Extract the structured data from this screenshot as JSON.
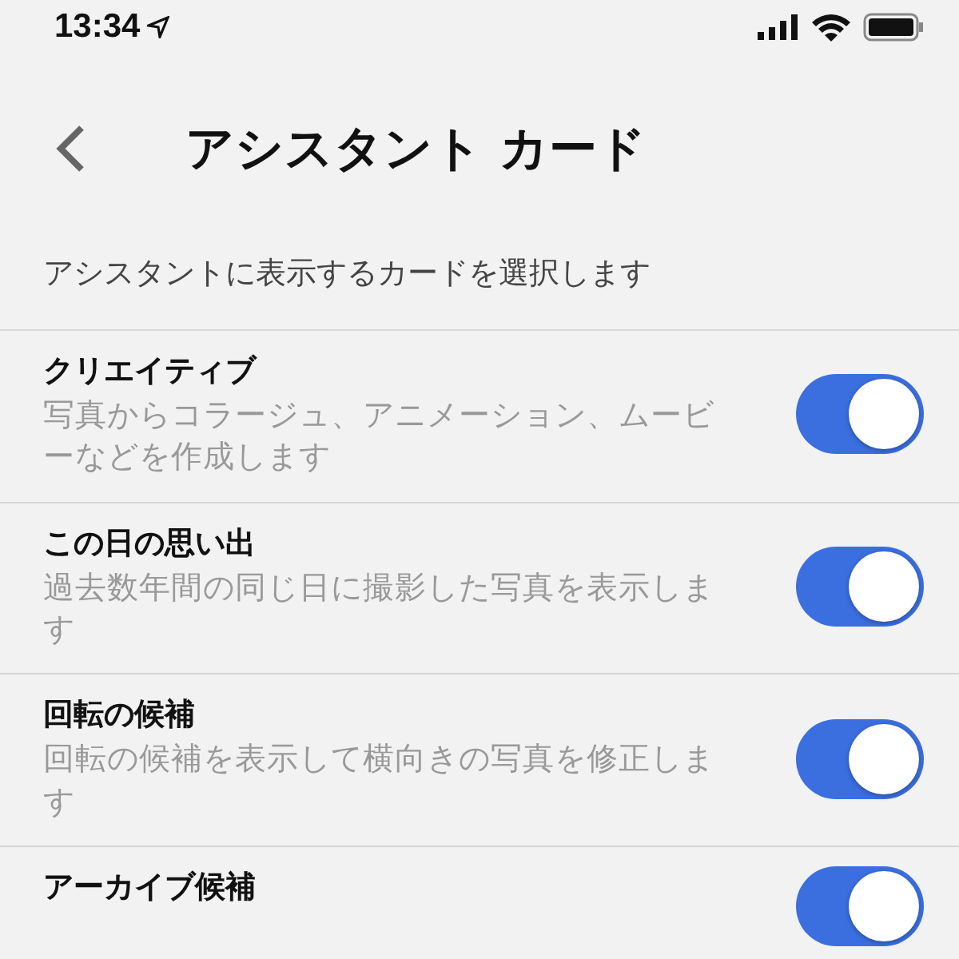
{
  "status_bar": {
    "time": "13:34"
  },
  "nav": {
    "title": "アシスタント カード"
  },
  "intro": "アシスタントに表示するカードを選択します",
  "cards": [
    {
      "title": "クリエイティブ",
      "description": "写真からコラージュ、アニメーション、ムービーなどを作成します",
      "on": true
    },
    {
      "title": "この日の思い出",
      "description": "過去数年間の同じ日に撮影した写真を表示します",
      "on": true
    },
    {
      "title": "回転の候補",
      "description": "回転の候補を表示して横向きの写真を修正します",
      "on": true
    },
    {
      "title": "アーカイブ候補",
      "on": true
    }
  ]
}
